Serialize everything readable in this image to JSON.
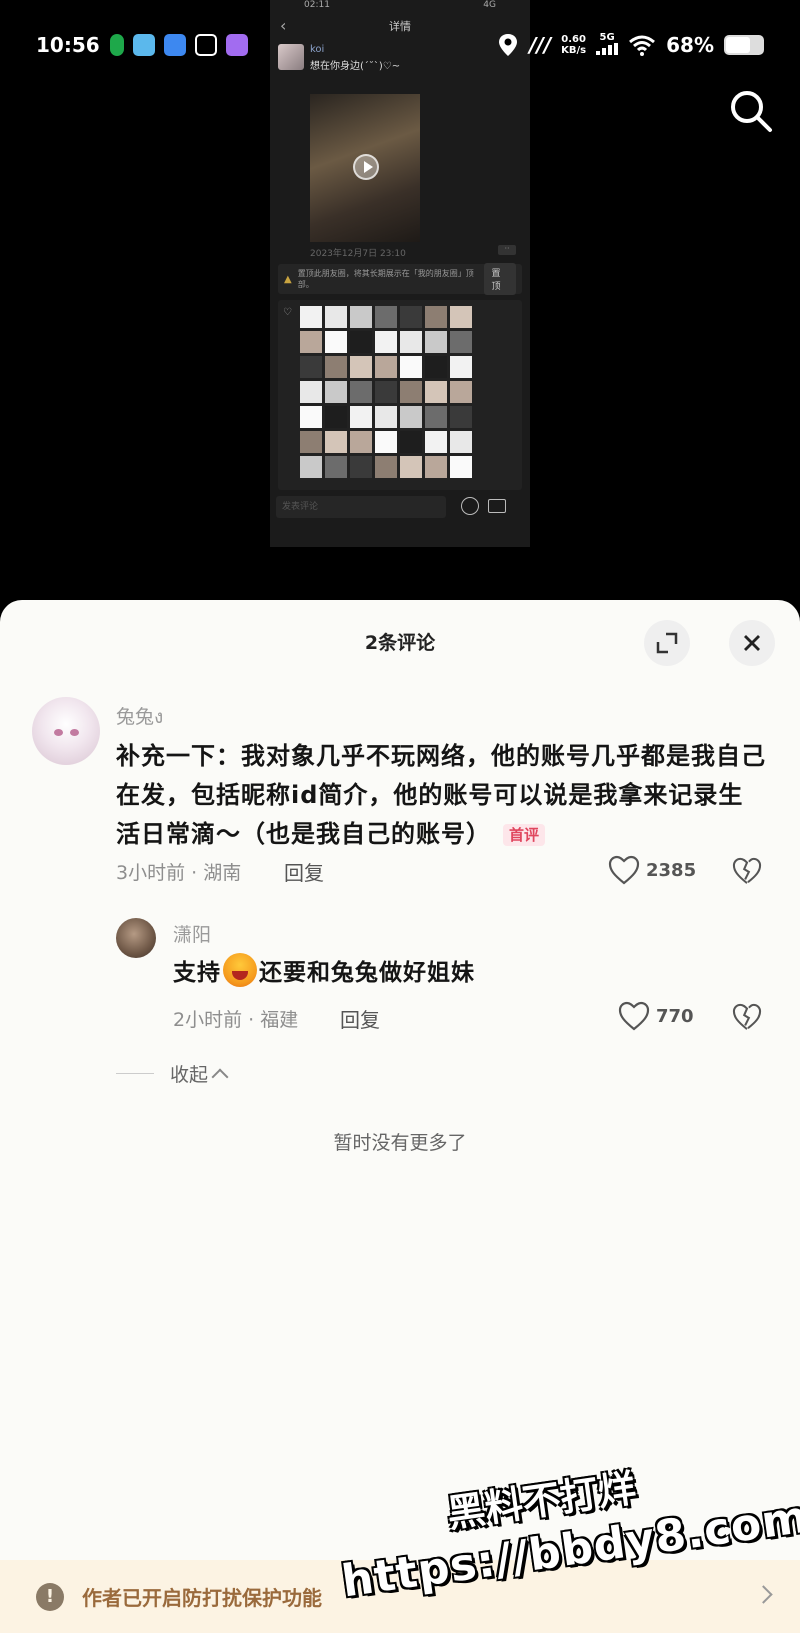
{
  "status_bar": {
    "time": "10:56",
    "speed_value": "0.60",
    "speed_unit": "KB/s",
    "network": "5G",
    "battery": "68%"
  },
  "embedded_screenshot": {
    "status_time": "02:11",
    "status_right": "4G",
    "header_title": "详情",
    "post_user": "koi",
    "post_text": "想在你身边(ˊ˘ˋ)♡~",
    "post_date": "2023年12月7日 23:10",
    "pin_text": "置顶此朋友圈，将其长期展示在「我的朋友圈」顶部。",
    "pin_button": "置顶",
    "comment_placeholder": "发表评论"
  },
  "comment_panel": {
    "title": "2条评论",
    "comments": [
      {
        "author": "兔兔ง",
        "text": "补充一下：我对象几乎不玩网络，他的账号几乎都是我自己在发，包括昵称id简介，他的账号可以说是我拿来记录生活日常滴～（也是我自己的账号）",
        "tag": "首评",
        "meta": "3小时前 · 湖南",
        "reply_label": "回复",
        "likes": "2385"
      }
    ],
    "replies": [
      {
        "author": "潇阳",
        "text_before": "支持",
        "text_after": "还要和兔兔做好姐妹",
        "meta": "2小时前 · 福建",
        "reply_label": "回复",
        "likes": "770"
      }
    ],
    "collapse_label": "收起",
    "no_more": "暂时没有更多了"
  },
  "banner": {
    "text": "作者已开启防打扰保护功能"
  },
  "watermark": {
    "line1": "黑料不打烊",
    "line2": "https://bbdy8.com"
  },
  "colors": {
    "sheet_bg": "#fbfbf8",
    "tag_red": "#e0465e",
    "banner_bg": "#fcf3e3"
  }
}
